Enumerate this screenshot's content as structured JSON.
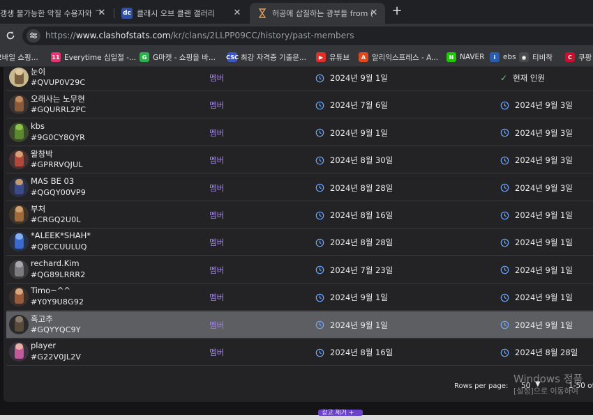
{
  "colors": {
    "role_accent": "#a184e8",
    "current_check": "#6fcf7f",
    "clock_icon": "#6ea8ff",
    "highlight_row": "#5d5e61"
  },
  "tabs": [
    {
      "label": "갱생 불가능한 악질 수용자와 ᄀ",
      "icon": "page-icon"
    },
    {
      "label": "클래시 오브 클랜 갤러리",
      "icon": "dcinside-icon"
    },
    {
      "label": "허공에 삽질하는 광부들 from (",
      "icon": "hourglass-icon"
    }
  ],
  "address": {
    "url_prefix": "https://",
    "url_host": "www.clashofstats.com",
    "url_path": "/kr/clans/2LLPP09CC/history/past-members"
  },
  "bookmarks": [
    {
      "label": "2바일 쇼핑...",
      "icon": "store-icon",
      "color": "#5a5a5a",
      "glyph": ""
    },
    {
      "label": "Everytime 십일절 -...",
      "icon": "11st-icon",
      "color": "#e8336e",
      "glyph": "11"
    },
    {
      "label": "G마켓 - 쇼핑을 바...",
      "icon": "gmarket-icon",
      "color": "#2bb24c",
      "glyph": "G"
    },
    {
      "label": "최강 자격증 기출문...",
      "icon": "exam-icon",
      "color": "#3c56c8",
      "glyph": "CSC"
    },
    {
      "label": "유튜브",
      "icon": "youtube-icon",
      "color": "#e52d27",
      "glyph": "▶"
    },
    {
      "label": "알리익스프레스 - A...",
      "icon": "aliexpress-icon",
      "color": "#e2471b",
      "glyph": "A"
    },
    {
      "label": "NAVER",
      "icon": "naver-icon",
      "color": "#1ec800",
      "glyph": "N"
    },
    {
      "label": "ebs",
      "icon": "ebs-icon",
      "color": "#2a5db0",
      "glyph": "i"
    },
    {
      "label": "티비착",
      "icon": "tv-icon",
      "color": "#4a4a4a",
      "glyph": "◉"
    },
    {
      "label": "쿠팡!",
      "icon": "coupang-icon",
      "color": "#c8102e",
      "glyph": "C"
    }
  ],
  "members": [
    {
      "name": "눈이",
      "tag": "#QVUP0V29C",
      "role": "멤버",
      "joined": "2024년 9월 1일",
      "left": "현재 인원",
      "current": true,
      "avatar": {
        "bg": "#c9b98f",
        "body": "#7a6040",
        "head": "#e2c7a0"
      }
    },
    {
      "name": "오래사는 노무현",
      "tag": "#GQURRL2PC",
      "role": "멤버",
      "joined": "2024년 7월 6일",
      "left": "2024년 9월 3일",
      "current": false,
      "avatar": {
        "bg": "#3a3330",
        "body": "#8a5a3a",
        "head": "#c28b5b"
      }
    },
    {
      "name": "kbs",
      "tag": "#9G0CY8QYR",
      "role": "멤버",
      "joined": "2024년 9월 1일",
      "left": "2024년 9월 3일",
      "current": false,
      "avatar": {
        "bg": "#3a4a2a",
        "body": "#5b8a2e",
        "head": "#8cc24a"
      }
    },
    {
      "name": "왈창박",
      "tag": "#GPRRVQJUL",
      "role": "멤버",
      "joined": "2024년 8월 30일",
      "left": "2024년 9월 3일",
      "current": false,
      "avatar": {
        "bg": "#4a3030",
        "body": "#b0483a",
        "head": "#d8a070"
      }
    },
    {
      "name": "MAS BE 03",
      "tag": "#QGQY00VP9",
      "role": "멤버",
      "joined": "2024년 8월 28일",
      "left": "2024년 9월 3일",
      "current": false,
      "avatar": {
        "bg": "#2a2f45",
        "body": "#3a4a8a",
        "head": "#c29a70"
      }
    },
    {
      "name": "부처",
      "tag": "#CRGQ2U0L",
      "role": "멤버",
      "joined": "2024년 8월 16일",
      "left": "2024년 9월 1일",
      "current": false,
      "avatar": {
        "bg": "#3f3428",
        "body": "#a06a3a",
        "head": "#d0a070"
      }
    },
    {
      "name": "*ALEEK*SHAH*",
      "tag": "#Q8CCUULUQ",
      "role": "멤버",
      "joined": "2024년 8월 28일",
      "left": "2024년 9월 1일",
      "current": false,
      "avatar": {
        "bg": "#25304a",
        "body": "#3a6ad0",
        "head": "#7fb0f0"
      }
    },
    {
      "name": "rechard.Kim",
      "tag": "#QG89LRRR2",
      "role": "멤버",
      "joined": "2024년 7월 23일",
      "left": "2024년 9월 1일",
      "current": false,
      "avatar": {
        "bg": "#3a3a3a",
        "body": "#7a7a80",
        "head": "#a8a8b0"
      }
    },
    {
      "name": "Timo~^^",
      "tag": "#Y0Y9U8G92",
      "role": "멤버",
      "joined": "2024년 9월 1일",
      "left": "2024년 9월 1일",
      "current": false,
      "avatar": {
        "bg": "#3a2e2a",
        "body": "#9a5a3a",
        "head": "#d8a880"
      }
    },
    {
      "name": "흑고추",
      "tag": "#GQYYQC9Y",
      "role": "멤버",
      "joined": "2024년 9월 1일",
      "left": "2024년 9월 1일",
      "current": false,
      "avatar": {
        "bg": "#2a2a2a",
        "body": "#5a4a3a",
        "head": "#8a7a6a"
      }
    },
    {
      "name": "player",
      "tag": "#G22V0JL2V",
      "role": "멤버",
      "joined": "2024년 8월 16일",
      "left": "2024년 8월 28일",
      "current": false,
      "avatar": {
        "bg": "#3a3040",
        "body": "#c05a9a",
        "head": "#e8b0a0"
      }
    }
  ],
  "pager": {
    "rows_label": "Rows per page:",
    "rows_value": "50",
    "range": "1-50 of"
  },
  "watermark": {
    "line1": "Windows 정품",
    "line2": "[설정]으로 이동하여"
  },
  "bottom_button": "광고 제거 +"
}
